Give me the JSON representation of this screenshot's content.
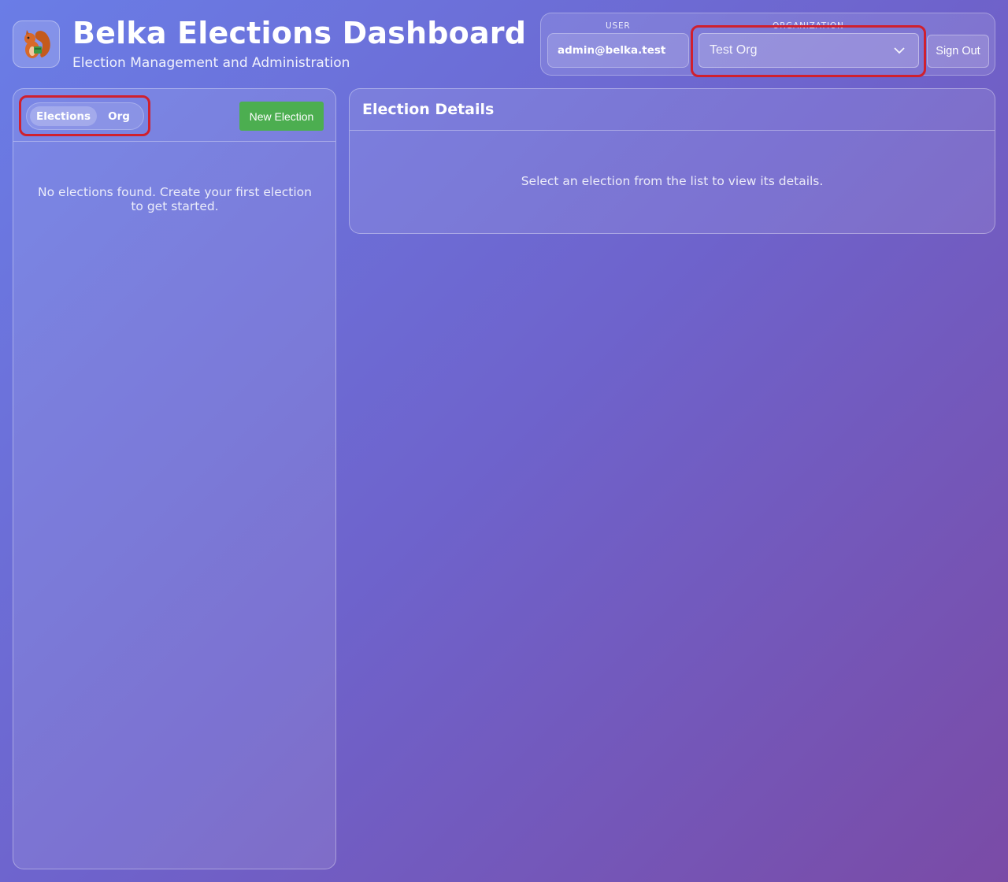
{
  "header": {
    "title": "Belka Elections Dashboard",
    "subtitle": "Election Management and Administration",
    "logo_icon": "squirrel-logo-icon"
  },
  "user_panel": {
    "user_label": "USER",
    "user_value": "admin@belka.test",
    "org_label": "ORGANIZATION",
    "org_selected": "Test Org",
    "sign_out_label": "Sign Out"
  },
  "sidebar": {
    "tabs": [
      {
        "label": "Elections",
        "active": true
      },
      {
        "label": "Org",
        "active": false
      }
    ],
    "new_election_label": "New Election",
    "empty_message": "No elections found. Create your first election to get started."
  },
  "details": {
    "title": "Election Details",
    "empty_message": "Select an election from the list to view its details."
  },
  "colors": {
    "background_start": "#6a7de6",
    "background_end": "#7a4ba6",
    "primary_button": "#4cae50",
    "highlight": "#d0202e"
  }
}
